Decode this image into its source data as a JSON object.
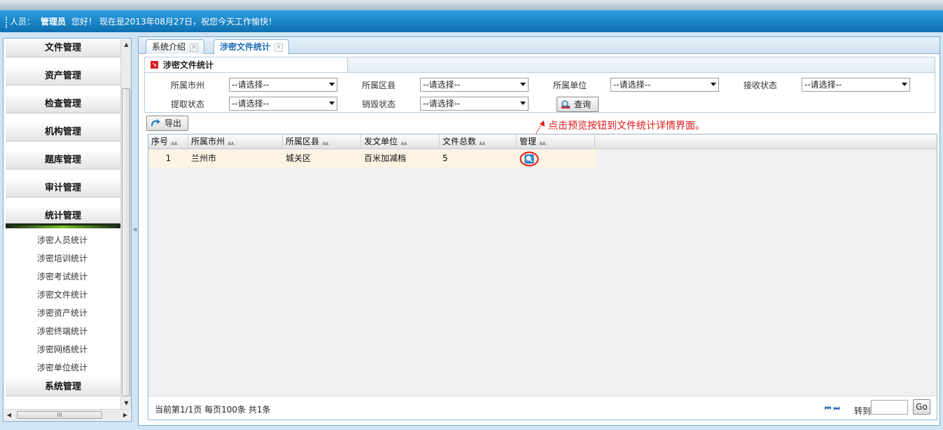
{
  "header": {
    "user_label": "人员：",
    "user_name": "管理员",
    "hello": "您好！",
    "greeting": "现在是2013年08月27日，祝您今天工作愉快！"
  },
  "sidebar": {
    "groups": [
      {
        "label": "文件管理"
      },
      {
        "label": "资产管理"
      },
      {
        "label": "检查管理"
      },
      {
        "label": "机构管理"
      },
      {
        "label": "题库管理"
      },
      {
        "label": "审计管理"
      },
      {
        "label": "统计管理"
      }
    ],
    "stat_items": [
      {
        "label": "涉密人员统计"
      },
      {
        "label": "涉密培训统计"
      },
      {
        "label": "涉密考试统计"
      },
      {
        "label": "涉密文件统计"
      },
      {
        "label": "涉密资产统计"
      },
      {
        "label": "涉密终端统计"
      },
      {
        "label": "涉密网络统计"
      },
      {
        "label": "涉密单位统计"
      }
    ],
    "last_group": "系统管理",
    "hscroll_grip": "III",
    "collapse": "«"
  },
  "tabs": [
    {
      "label": "系统介绍",
      "active": false
    },
    {
      "label": "涉密文件统计",
      "active": true
    }
  ],
  "filter": {
    "title": "涉密文件统计",
    "city_label": "所属市州",
    "county_label": "所属区县",
    "unit_label": "所属单位",
    "receive_label": "接收状态",
    "extract_label": "提取状态",
    "destroy_label": "销毁状态",
    "placeholder": "--请选择--",
    "query_label": "查询"
  },
  "toolbar": {
    "export_label": "导出"
  },
  "annotation": "点击预览按钮到文件统计详情界面。",
  "table": {
    "columns": [
      "序号",
      "所属市州",
      "所属区县",
      "发文单位",
      "文件总数",
      "管理"
    ],
    "rows": [
      [
        "1",
        "兰州市",
        "城关区",
        "百米加减档",
        "5"
      ]
    ]
  },
  "pager": {
    "info": "当前第1/1页  每页100条  共1条",
    "first": "⏮",
    "last": "⏭",
    "goto_label": "转到",
    "go_label": "Go"
  },
  "colors": {
    "header_blue": "#1b7fc1",
    "accent_red": "#e01818",
    "row_highlight": "#fdf3e3"
  }
}
